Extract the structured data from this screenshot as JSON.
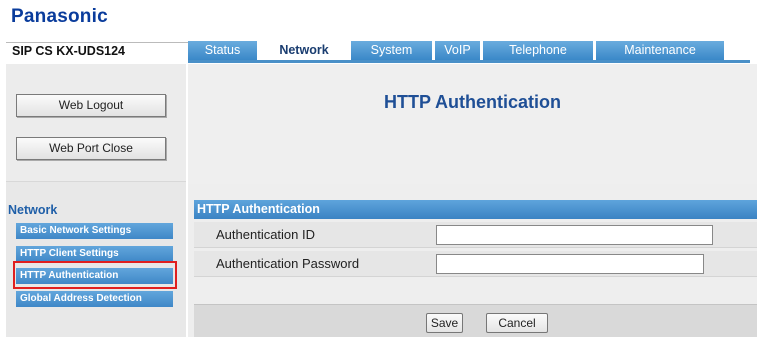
{
  "brand": {
    "logo_text": "Panasonic"
  },
  "model": {
    "name": "SIP CS KX-UDS124"
  },
  "tabs": [
    {
      "label": "Status"
    },
    {
      "label": "Network"
    },
    {
      "label": "System"
    },
    {
      "label": "VoIP"
    },
    {
      "label": "Telephone"
    },
    {
      "label": "Maintenance"
    }
  ],
  "active_tab": "Network",
  "sidebar": {
    "web_logout_label": "Web Logout",
    "web_port_close_label": "Web Port Close",
    "section_label": "Network",
    "items": [
      {
        "label": "Basic Network Settings"
      },
      {
        "label": "HTTP Client Settings"
      },
      {
        "label": "HTTP Authentication"
      },
      {
        "label": "Global Address Detection"
      }
    ],
    "selected_item": "HTTP Authentication"
  },
  "main": {
    "page_title": "HTTP Authentication",
    "panel_header": "HTTP Authentication",
    "fields": [
      {
        "label": "Authentication ID",
        "value": ""
      },
      {
        "label": "Authentication Password",
        "value": ""
      }
    ],
    "save_label": "Save",
    "cancel_label": "Cancel"
  },
  "colors": {
    "brand_blue": "#0a3c9c",
    "tab_blue": "#3a88c8",
    "title_blue": "#1f4f96",
    "highlight_red": "#e02020"
  }
}
